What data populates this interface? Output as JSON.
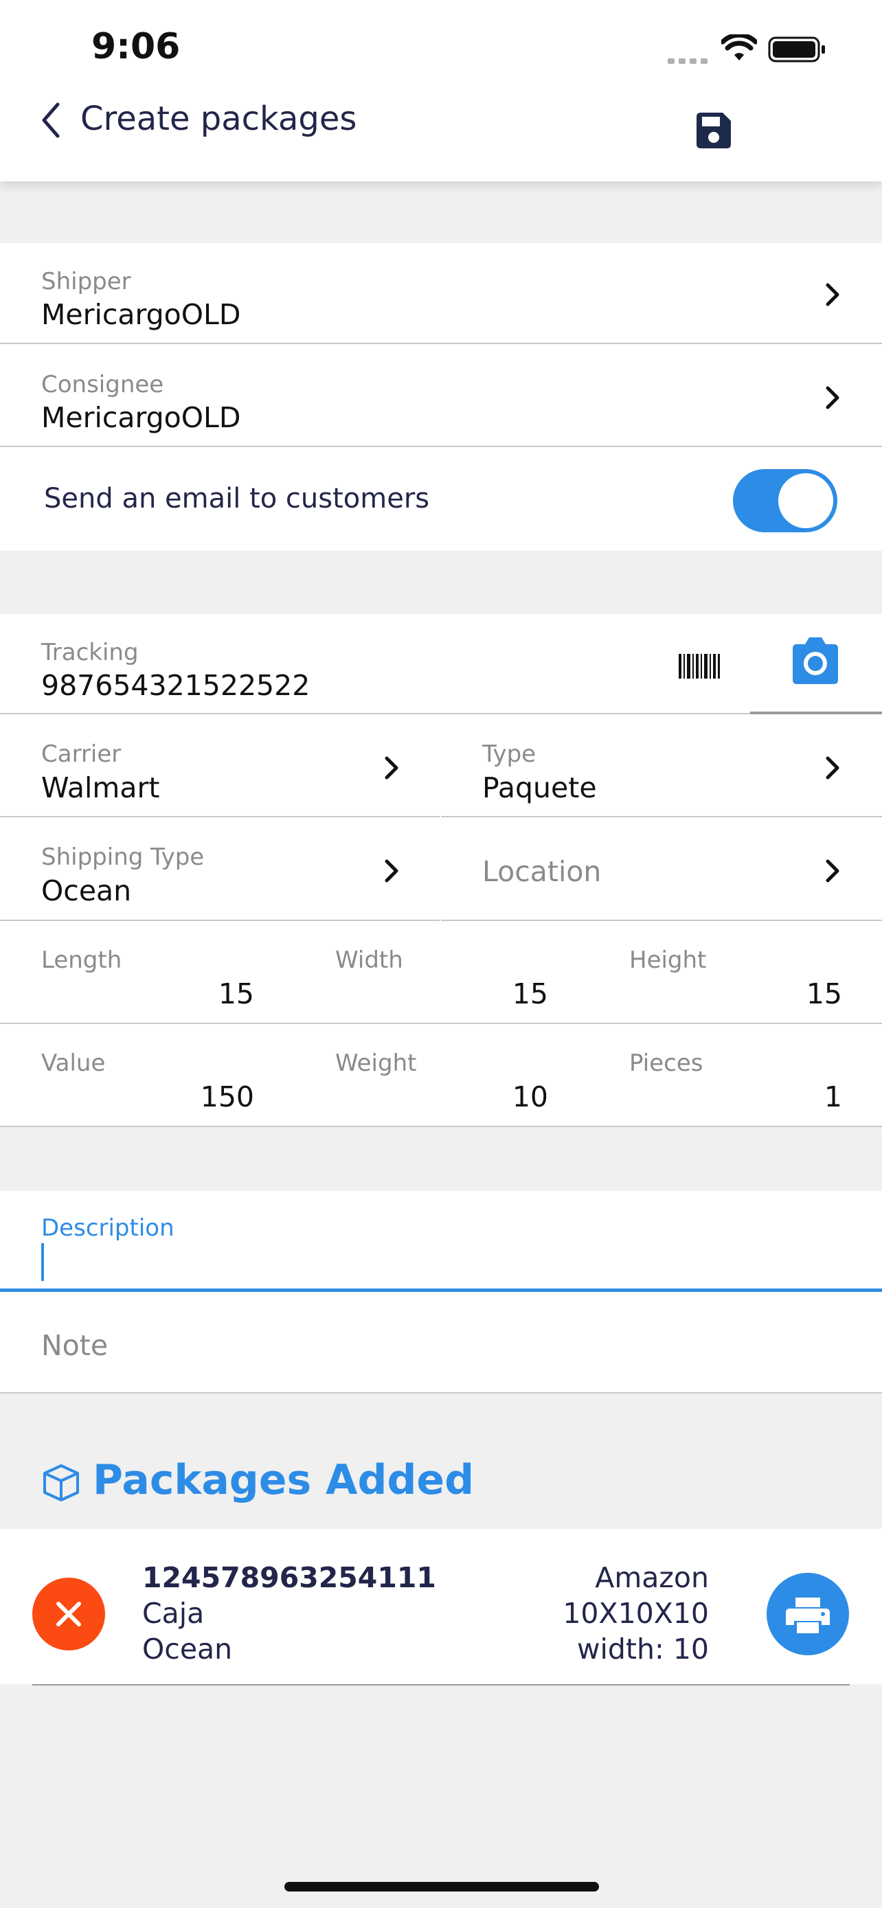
{
  "status_bar": {
    "time": "9:06"
  },
  "nav": {
    "title": "Create packages",
    "back_icon": "chevron-left-icon",
    "save_icon": "save-floppy-icon"
  },
  "customers": {
    "shipper": {
      "label": "Shipper",
      "value": "MericargoOLD"
    },
    "consignee": {
      "label": "Consignee",
      "value": "MericargoOLD"
    },
    "email": {
      "label": "Send an email to customers",
      "enabled": true
    }
  },
  "package": {
    "tracking": {
      "label": "Tracking",
      "value": "987654321522522"
    },
    "carrier": {
      "label": "Carrier",
      "value": "Walmart"
    },
    "type": {
      "label": "Type",
      "value": "Paquete"
    },
    "shipping_type": {
      "label": "Shipping Type",
      "value": "Ocean"
    },
    "location": {
      "label": "Location"
    },
    "length": {
      "label": "Length",
      "value": "15"
    },
    "width": {
      "label": "Width",
      "value": "15"
    },
    "height": {
      "label": "Height",
      "value": "15"
    },
    "value": {
      "label": "Value",
      "value": "150"
    },
    "weight": {
      "label": "Weight",
      "value": "10"
    },
    "pieces": {
      "label": "Pieces",
      "value": "1"
    }
  },
  "notes": {
    "description": {
      "label": "Description",
      "value": ""
    },
    "note": {
      "placeholder": "Note"
    }
  },
  "packages_added": {
    "title": "Packages Added",
    "items": [
      {
        "tracking": "124578963254111",
        "type": "Caja",
        "shipping": "Ocean",
        "carrier": "Amazon",
        "dims": "10X10X10",
        "width": "width: 10"
      }
    ]
  },
  "colors": {
    "accent": "#2d8ce6",
    "danger": "#fb4a12",
    "navy": "#23264a",
    "background": "#f0f0f0"
  }
}
